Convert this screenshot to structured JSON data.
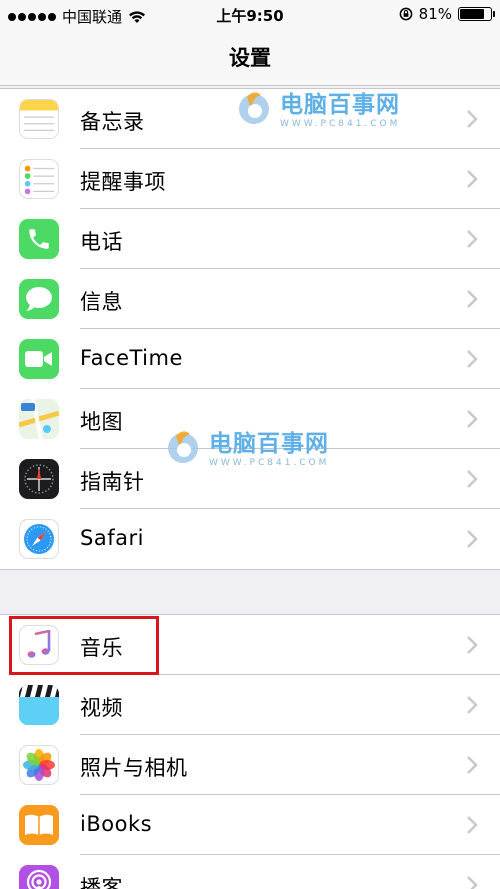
{
  "status_bar": {
    "carrier": "中国联通",
    "time": "上午9:50",
    "battery_percent": "81%",
    "battery_level": 0.81
  },
  "nav": {
    "title": "设置"
  },
  "group1": [
    {
      "label": "备忘录",
      "icon": "notes-icon"
    },
    {
      "label": "提醒事项",
      "icon": "reminders-icon"
    },
    {
      "label": "电话",
      "icon": "phone-icon"
    },
    {
      "label": "信息",
      "icon": "messages-icon"
    },
    {
      "label": "FaceTime",
      "icon": "facetime-icon"
    },
    {
      "label": "地图",
      "icon": "maps-icon"
    },
    {
      "label": "指南针",
      "icon": "compass-icon"
    },
    {
      "label": "Safari",
      "icon": "safari-icon"
    }
  ],
  "group2": [
    {
      "label": "音乐",
      "icon": "music-icon"
    },
    {
      "label": "视频",
      "icon": "videos-icon"
    },
    {
      "label": "照片与相机",
      "icon": "photos-icon"
    },
    {
      "label": "iBooks",
      "icon": "ibooks-icon"
    },
    {
      "label": "播客",
      "icon": "podcasts-icon"
    }
  ],
  "watermark": {
    "name": "电脑百事网",
    "url": "WWW.PC841.COM"
  },
  "colors": {
    "highlight": "#d8161b",
    "phone_green": "#4cd964",
    "podcasts_purple": "#b150e2",
    "ibooks_orange": "#f79a1e"
  }
}
